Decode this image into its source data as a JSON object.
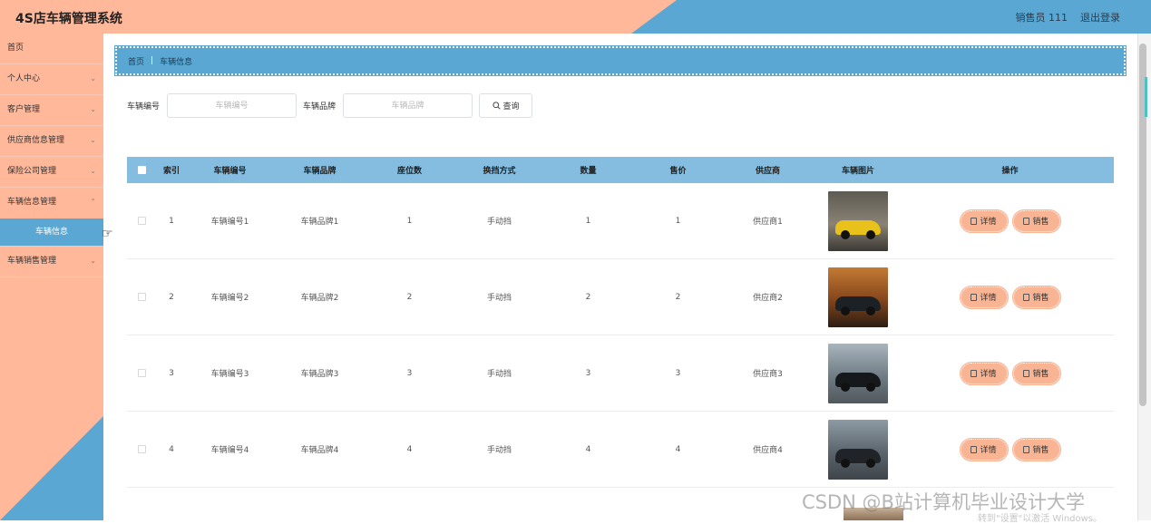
{
  "header": {
    "app_title": "4S店车辆管理系统",
    "user_label": "销售员 111",
    "logout_label": "退出登录"
  },
  "sidebar": {
    "items": [
      {
        "label": "首页",
        "expandable": false
      },
      {
        "label": "个人中心",
        "expandable": true
      },
      {
        "label": "客户管理",
        "expandable": true
      },
      {
        "label": "供应商信息管理",
        "expandable": true
      },
      {
        "label": "保险公司管理",
        "expandable": true
      },
      {
        "label": "车辆信息管理",
        "expandable": true,
        "expanded": true
      },
      {
        "label": "车辆销售管理",
        "expandable": true
      }
    ],
    "active_subitem": "车辆信息"
  },
  "breadcrumb": {
    "home": "首页",
    "current": "车辆信息"
  },
  "search": {
    "vehicle_no_label": "车辆编号",
    "vehicle_no_placeholder": "车辆编号",
    "brand_label": "车辆品牌",
    "brand_placeholder": "车辆品牌",
    "query_label": "查询"
  },
  "table": {
    "headers": {
      "index": "索引",
      "vehicle_no": "车辆编号",
      "brand": "车辆品牌",
      "seats": "座位数",
      "gear": "换挡方式",
      "quantity": "数量",
      "price": "售价",
      "supplier": "供应商",
      "image": "车辆图片",
      "actions": "操作"
    },
    "rows": [
      {
        "index": "1",
        "vehicle_no": "车辆编号1",
        "brand": "车辆品牌1",
        "seats": "1",
        "gear": "手动挡",
        "quantity": "1",
        "price": "1",
        "supplier": "供应商1",
        "image": "yellow-sports-car"
      },
      {
        "index": "2",
        "vehicle_no": "车辆编号2",
        "brand": "车辆品牌2",
        "seats": "2",
        "gear": "手动挡",
        "quantity": "2",
        "price": "2",
        "supplier": "供应商2",
        "image": "black-car-sunset"
      },
      {
        "index": "3",
        "vehicle_no": "车辆编号3",
        "brand": "车辆品牌3",
        "seats": "3",
        "gear": "手动挡",
        "quantity": "3",
        "price": "3",
        "supplier": "供应商3",
        "image": "black-suv"
      },
      {
        "index": "4",
        "vehicle_no": "车辆编号4",
        "brand": "车辆品牌4",
        "seats": "4",
        "gear": "手动挡",
        "quantity": "4",
        "price": "4",
        "supplier": "供应商4",
        "image": "black-sedan"
      }
    ],
    "action_detail": "详情",
    "action_sell": "销售"
  },
  "watermark": {
    "main": "CSDN @B站计算机毕业设计大学",
    "sub": "转到\"设置\"以激活 Windows。"
  },
  "colors": {
    "peach": "#ffb89a",
    "blue": "#59a7d2",
    "table_header": "#85bde0",
    "action_button": "#f9b494"
  }
}
